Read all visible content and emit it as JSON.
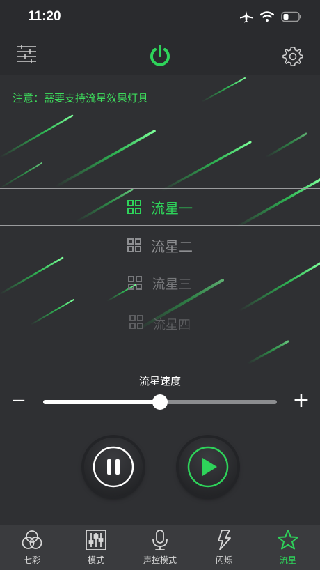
{
  "status_bar": {
    "time": "11:20"
  },
  "main": {
    "notice": "注意：需要支持流星效果灯具",
    "effects": [
      {
        "label": "流星一",
        "selected": true
      },
      {
        "label": "流星二",
        "selected": false
      },
      {
        "label": "流星三",
        "selected": false
      },
      {
        "label": "流星四",
        "selected": false
      }
    ],
    "speed_label": "流星速度",
    "speed_minus": "−",
    "speed_plus": "+",
    "speed_value": 0.5
  },
  "tabs": [
    {
      "label": "七彩",
      "icon": "rings-icon",
      "active": false
    },
    {
      "label": "模式",
      "icon": "sliders-icon",
      "active": false
    },
    {
      "label": "声控模式",
      "icon": "microphone-icon",
      "active": false
    },
    {
      "label": "闪烁",
      "icon": "lightning-icon",
      "active": false
    },
    {
      "label": "流星",
      "icon": "star-icon",
      "active": true
    }
  ],
  "colors": {
    "accent": "#2ed35a",
    "background": "#2a2b2e"
  }
}
